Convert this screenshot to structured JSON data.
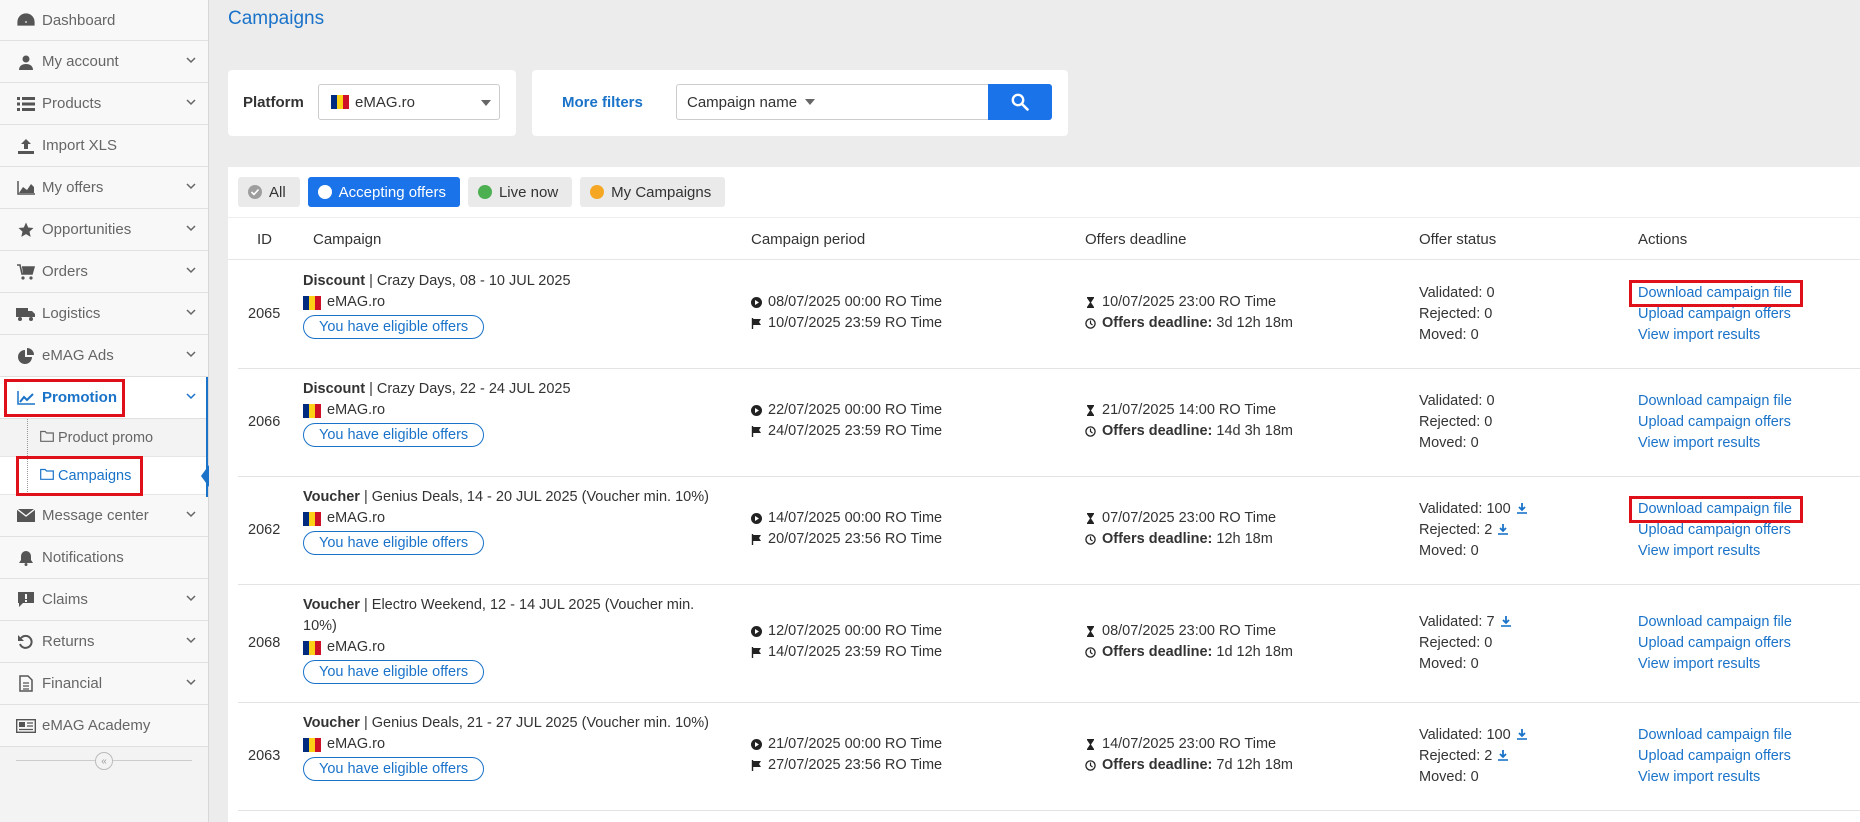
{
  "sidebar": {
    "items": [
      {
        "label": "Dashboard",
        "icon": "dashboard-icon"
      },
      {
        "label": "My account",
        "icon": "user-icon"
      },
      {
        "label": "Products",
        "icon": "list-icon"
      },
      {
        "label": "Import XLS",
        "icon": "upload-icon"
      },
      {
        "label": "My offers",
        "icon": "area-chart-icon"
      },
      {
        "label": "Opportunities",
        "icon": "star-icon"
      },
      {
        "label": "Orders",
        "icon": "cart-icon"
      },
      {
        "label": "Logistics",
        "icon": "truck-icon"
      },
      {
        "label": "eMAG Ads",
        "icon": "pie-chart-icon"
      },
      {
        "label": "Promotion",
        "icon": "line-chart-icon"
      },
      {
        "label": "Message center",
        "icon": "envelope-icon"
      },
      {
        "label": "Notifications",
        "icon": "bell-icon"
      },
      {
        "label": "Claims",
        "icon": "comment-alert-icon"
      },
      {
        "label": "Returns",
        "icon": "undo-icon"
      },
      {
        "label": "Financial",
        "icon": "document-icon"
      },
      {
        "label": "eMAG Academy",
        "icon": "newspaper-icon"
      }
    ],
    "promotion_sub": [
      {
        "label": "Product promo"
      },
      {
        "label": "Campaigns"
      }
    ]
  },
  "page": {
    "title": "Campaigns"
  },
  "filters": {
    "platform_label": "Platform",
    "platform_value": "eMAG.ro",
    "more_filters": "More filters",
    "campaign_field": "Campaign name"
  },
  "tabs": {
    "all": "All",
    "accepting": "Accepting offers",
    "live": "Live now",
    "mine": "My Campaigns"
  },
  "table": {
    "headers": {
      "id": "ID",
      "campaign": "Campaign",
      "period": "Campaign period",
      "deadline": "Offers deadline",
      "status": "Offer status",
      "actions": "Actions"
    },
    "eligible_label": "You have eligible offers",
    "deadline_label": "Offers deadline:",
    "validated_label": "Validated:",
    "rejected_label": "Rejected:",
    "moved_label": "Moved:",
    "action_download": "Download campaign file",
    "action_upload": "Upload campaign offers",
    "action_view": "View import results",
    "rows": [
      {
        "id": "2065",
        "type": "Discount",
        "name": "| Crazy Days, 08 - 10 JUL 2025",
        "platform": "eMAG.ro",
        "start": "08/07/2025 00:00 RO Time",
        "end": "10/07/2025 23:59 RO Time",
        "deadline_date": "10/07/2025 23:00 RO Time",
        "deadline_left": "3d 12h 18m",
        "validated": "0",
        "rejected": "0",
        "moved": "0"
      },
      {
        "id": "2066",
        "type": "Discount",
        "name": "| Crazy Days, 22 - 24 JUL 2025",
        "platform": "eMAG.ro",
        "start": "22/07/2025 00:00 RO Time",
        "end": "24/07/2025 23:59 RO Time",
        "deadline_date": "21/07/2025 14:00 RO Time",
        "deadline_left": "14d 3h 18m",
        "validated": "0",
        "rejected": "0",
        "moved": "0"
      },
      {
        "id": "2062",
        "type": "Voucher",
        "name": "| Genius Deals, 14 - 20 JUL 2025 (Voucher min. 10%)",
        "platform": "eMAG.ro",
        "start": "14/07/2025 00:00 RO Time",
        "end": "20/07/2025 23:56 RO Time",
        "deadline_date": "07/07/2025 23:00 RO Time",
        "deadline_left": "12h 18m",
        "validated": "100",
        "rejected": "2",
        "moved": "0"
      },
      {
        "id": "2068",
        "type": "Voucher",
        "name": "| Electro Weekend, 12 - 14 JUL 2025 (Voucher min.",
        "name2": "10%)",
        "platform": "eMAG.ro",
        "start": "12/07/2025 00:00 RO Time",
        "end": "14/07/2025 23:59 RO Time",
        "deadline_date": "08/07/2025 23:00 RO Time",
        "deadline_left": "1d 12h 18m",
        "validated": "7",
        "rejected": "0",
        "moved": "0"
      },
      {
        "id": "2063",
        "type": "Voucher",
        "name": "| Genius Deals, 21 - 27 JUL 2025 (Voucher min. 10%)",
        "platform": "eMAG.ro",
        "start": "21/07/2025 00:00 RO Time",
        "end": "27/07/2025 23:56 RO Time",
        "deadline_date": "14/07/2025 23:00 RO Time",
        "deadline_left": "7d 12h 18m",
        "validated": "100",
        "rejected": "2",
        "moved": "0"
      }
    ]
  },
  "colors": {
    "accent": "#1a73c9",
    "button": "#1a73e8",
    "highlight": "#e0101a",
    "live": "#4caf50",
    "mine": "#f5a623"
  }
}
